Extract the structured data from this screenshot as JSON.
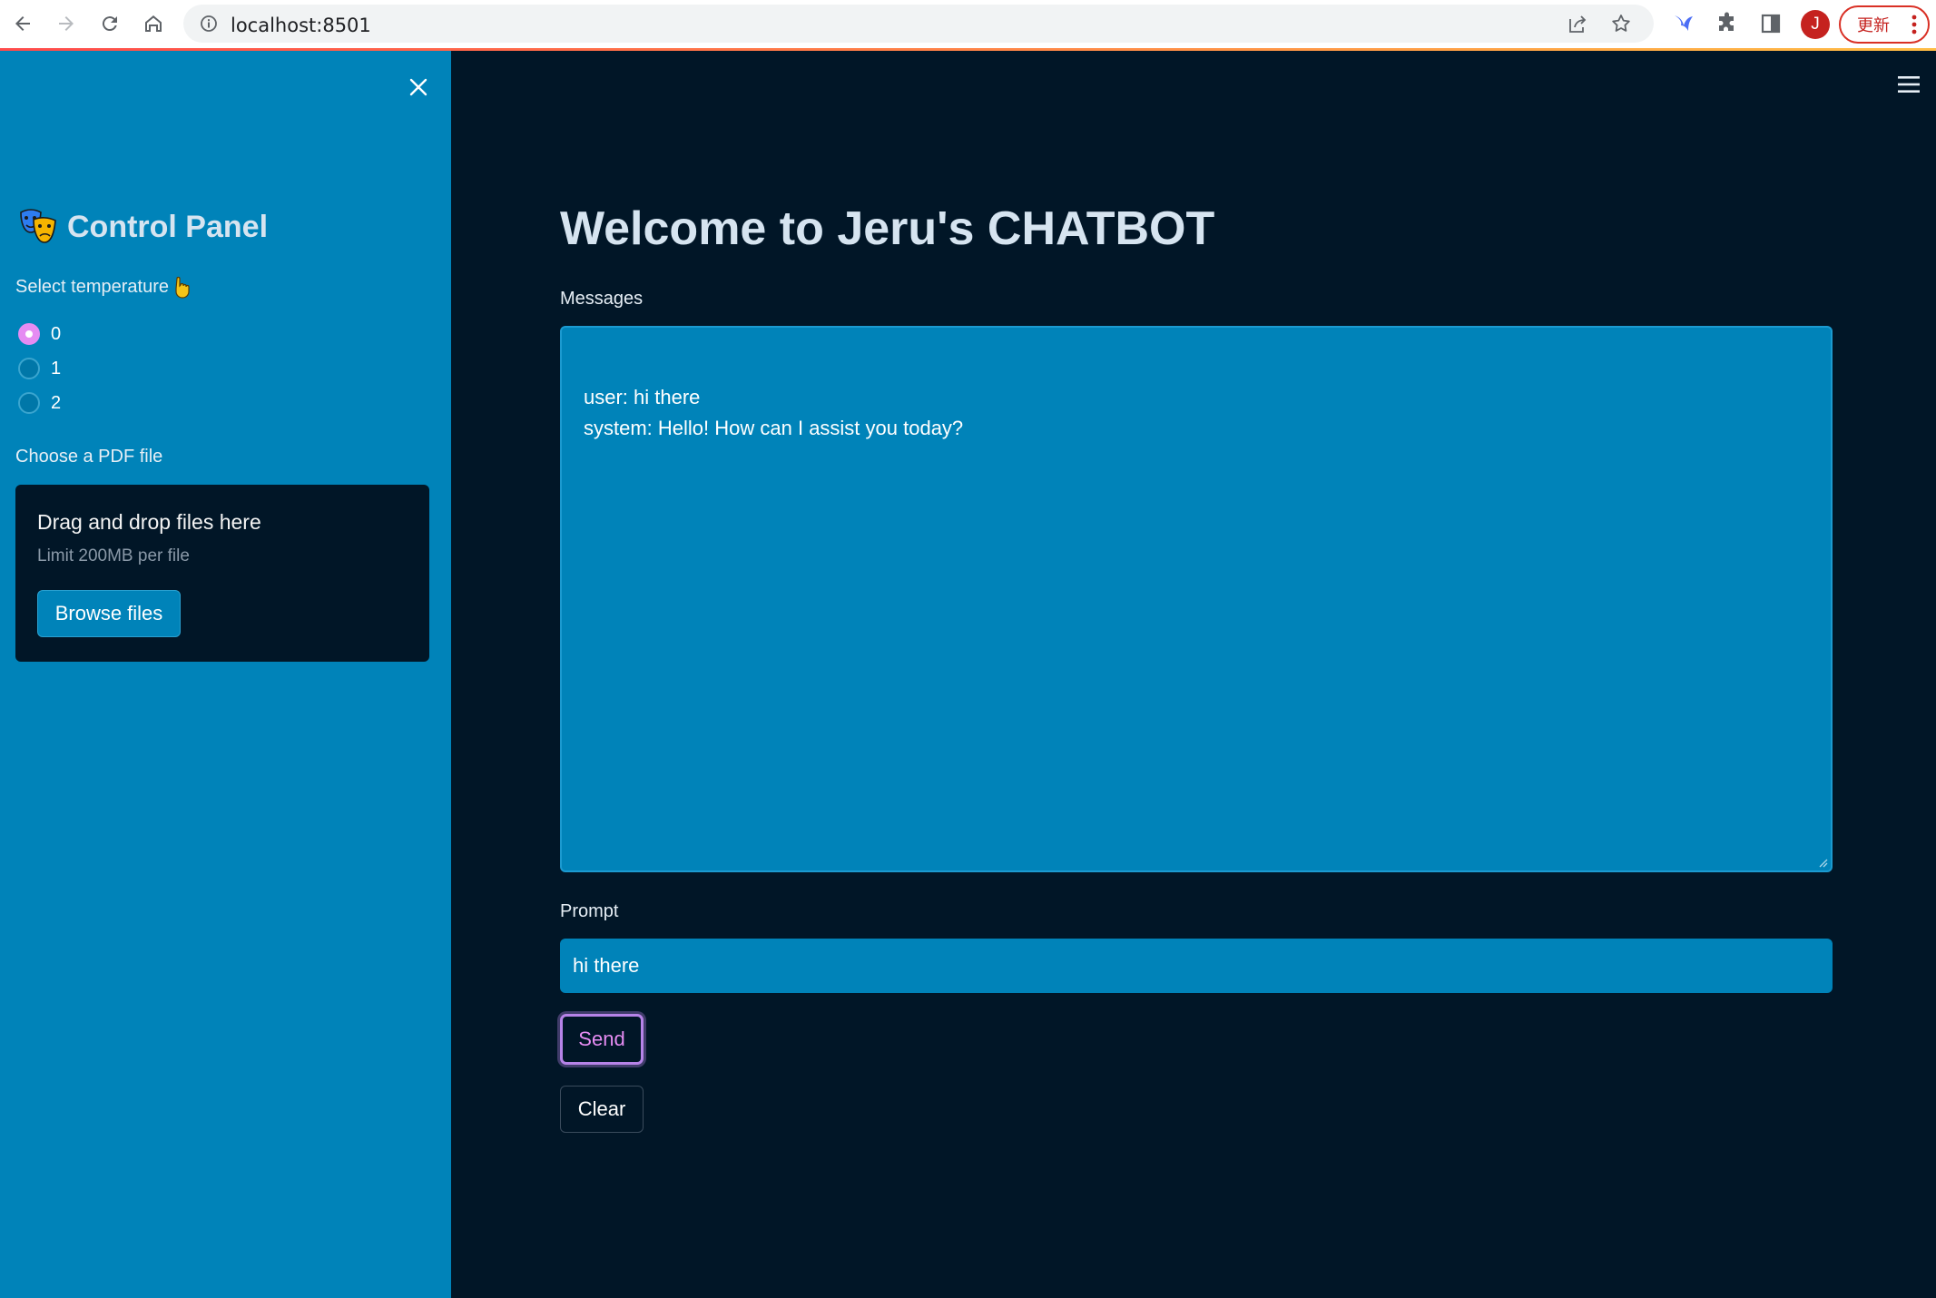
{
  "browser": {
    "url": "localhost:8501",
    "profile_initial": "J",
    "update_label": "更新"
  },
  "sidebar": {
    "title": "Control Panel",
    "temperature_label": "Select temperature",
    "temperature_options": [
      "0",
      "1",
      "2"
    ],
    "temperature_selected": "0",
    "pdf_label": "Choose a PDF file",
    "dropzone_title": "Drag and drop files here",
    "dropzone_limit": "Limit 200MB per file",
    "browse_label": "Browse files"
  },
  "main": {
    "title": "Welcome to Jeru's CHATBOT",
    "messages_label": "Messages",
    "messages_text": "user: hi there\nsystem: Hello! How can I assist you today?",
    "prompt_label": "Prompt",
    "prompt_value": "hi there",
    "send_label": "Send",
    "clear_label": "Clear"
  },
  "colors": {
    "sidebar_bg": "#0083b9",
    "main_bg": "#011627",
    "accent": "#e58cf2",
    "input_bg": "#0083b9"
  },
  "icons": [
    "back-icon",
    "forward-icon",
    "reload-icon",
    "home-icon",
    "info-icon",
    "share-icon",
    "star-icon",
    "extension-icon",
    "puzzle-icon",
    "side-panel-icon",
    "close-icon",
    "theater-masks-icon",
    "pointing-hand-icon",
    "hamburger-menu-icon"
  ]
}
